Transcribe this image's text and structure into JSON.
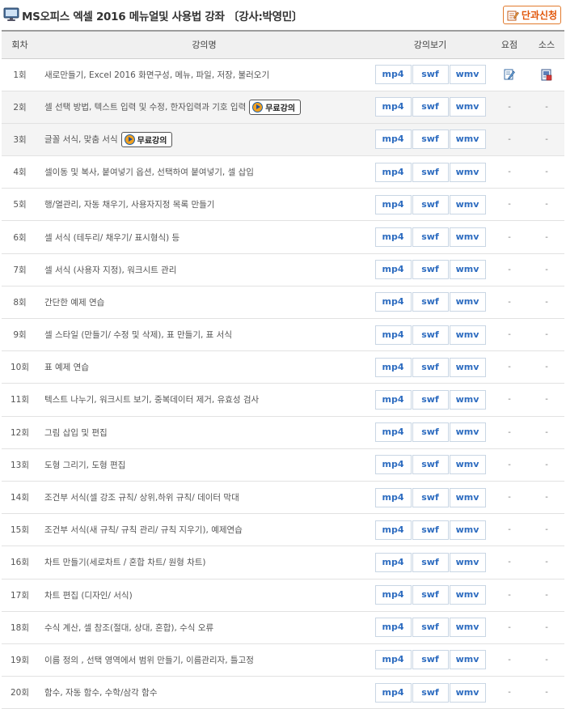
{
  "header": {
    "title": "MS오피스 엑셀 2016 메뉴얼및 사용법 강좌 〔강사:박영민〕",
    "apply_label": "단과신청"
  },
  "table": {
    "columns": {
      "num": "회차",
      "name": "강의명",
      "view": "강의보기",
      "summary": "요점",
      "source": "소스"
    },
    "formats": [
      "mp4",
      "swf",
      "wmv"
    ],
    "free_label": "무료강의",
    "dash": "-",
    "rows": [
      {
        "num": "1회",
        "name": "새로만들기, Excel 2016 화면구성, 메뉴, 파일, 저장, 불러오기",
        "free": false,
        "has_files": true
      },
      {
        "num": "2회",
        "name": "셀 선택 방법, 텍스트 입력 및 수정, 한자입력과 기호 입력",
        "free": true,
        "has_files": false
      },
      {
        "num": "3회",
        "name": "글꼴 서식, 맞춤 서식",
        "free": true,
        "has_files": false
      },
      {
        "num": "4회",
        "name": "셀이동 및 복사, 붙여넣기 옵션, 선택하여 붙여넣기, 셀 삽입",
        "free": false,
        "has_files": false
      },
      {
        "num": "5회",
        "name": "행/열관리, 자동 채우기, 사용자지정 목록 만들기",
        "free": false,
        "has_files": false
      },
      {
        "num": "6회",
        "name": "셀 서식 (테두리/ 채우기/ 표시형식) 등",
        "free": false,
        "has_files": false
      },
      {
        "num": "7회",
        "name": "셀 서식 (사용자 지정), 워크시트 관리",
        "free": false,
        "has_files": false
      },
      {
        "num": "8회",
        "name": "간단한 예제 연습",
        "free": false,
        "has_files": false
      },
      {
        "num": "9회",
        "name": "셀 스타일 (만들기/ 수정 및 삭제), 표 만들기, 표 서식",
        "free": false,
        "has_files": false
      },
      {
        "num": "10회",
        "name": "표 예제 연습",
        "free": false,
        "has_files": false
      },
      {
        "num": "11회",
        "name": "텍스트 나누기, 워크시트 보기, 중복데이터 제거, 유효성 검사",
        "free": false,
        "has_files": false
      },
      {
        "num": "12회",
        "name": "그림 삽입 및 편집",
        "free": false,
        "has_files": false
      },
      {
        "num": "13회",
        "name": "도형 그리기, 도형 편집",
        "free": false,
        "has_files": false
      },
      {
        "num": "14회",
        "name": "조건부 서식(셀 강조 규칙/ 상위,하위 규칙/ 데이터 막대",
        "free": false,
        "has_files": false
      },
      {
        "num": "15회",
        "name": "조건부 서식(새 규칙/ 규칙 관리/ 규칙 지우기), 예제연습",
        "free": false,
        "has_files": false
      },
      {
        "num": "16회",
        "name": "차트 만들기(세로차트 / 혼합 차트/ 원형 차트)",
        "free": false,
        "has_files": false
      },
      {
        "num": "17회",
        "name": "차트 편집 (디자인/ 서식)",
        "free": false,
        "has_files": false
      },
      {
        "num": "18회",
        "name": "수식 계산, 셀 참조(절대, 상대, 혼합), 수식 오류",
        "free": false,
        "has_files": false
      },
      {
        "num": "19회",
        "name": "이름 정의 , 선택 영역에서 범위 만들기, 이름관리자, 틀고정",
        "free": false,
        "has_files": false
      },
      {
        "num": "20회",
        "name": "함수, 자동 함수, 수학/삼각 함수",
        "free": false,
        "has_files": false
      }
    ]
  }
}
